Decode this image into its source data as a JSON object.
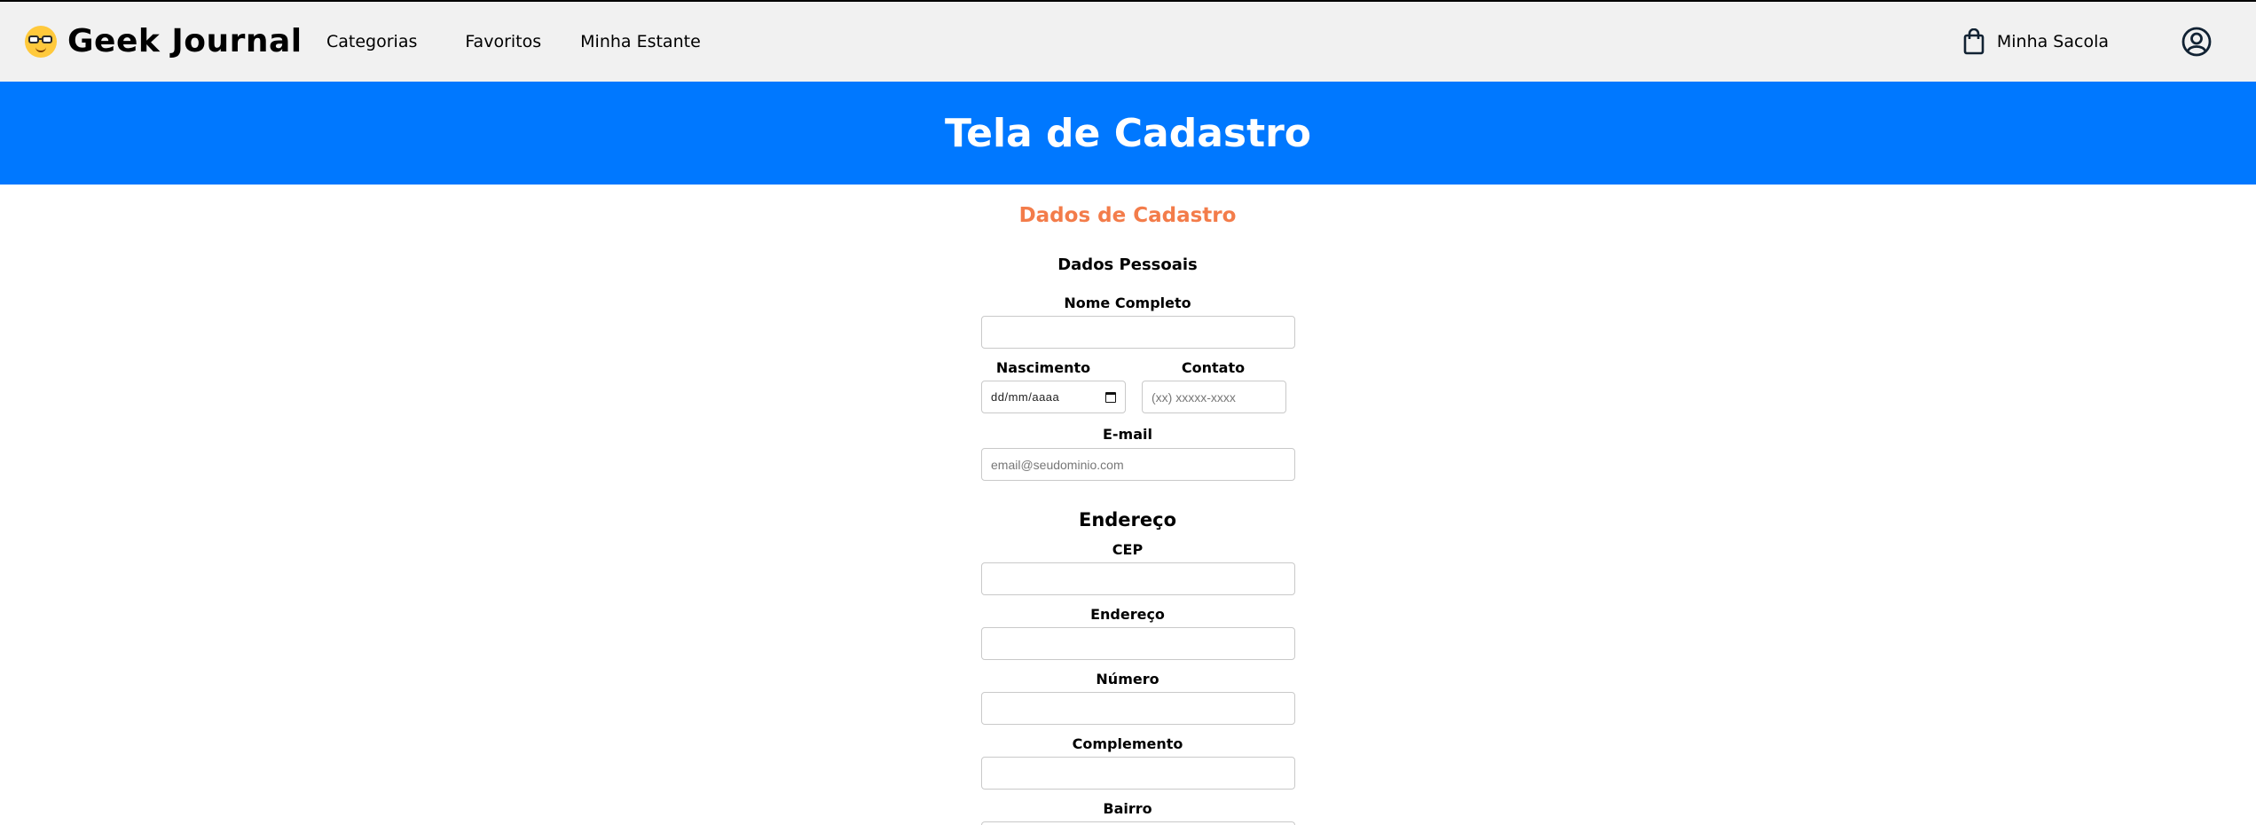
{
  "header": {
    "brand": "Geek Journal",
    "nav": [
      "Categorias",
      "Favoritos",
      "Minha Estante"
    ],
    "bag_label": "Minha Sacola"
  },
  "banner": {
    "title": "Tela de Cadastro"
  },
  "form": {
    "title": "Dados de Cadastro",
    "personal_title": "Dados Pessoais",
    "fields": {
      "nome_label": "Nome Completo",
      "nascimento_label": "Nascimento",
      "nascimento_value": "dd/mm/aaaa",
      "contato_label": "Contato",
      "contato_placeholder": "(xx) xxxxx-xxxx",
      "email_label": "E-mail",
      "email_placeholder": "email@seudominio.com"
    },
    "address_title": "Endereço",
    "address": {
      "cep_label": "CEP",
      "endereco_label": "Endereço",
      "numero_label": "Número",
      "complemento_label": "Complemento",
      "bairro_label": "Bairro"
    }
  },
  "colors": {
    "accent": "#0078ff",
    "section_title": "#f37c4a",
    "navbar": "#f1f1f1"
  }
}
